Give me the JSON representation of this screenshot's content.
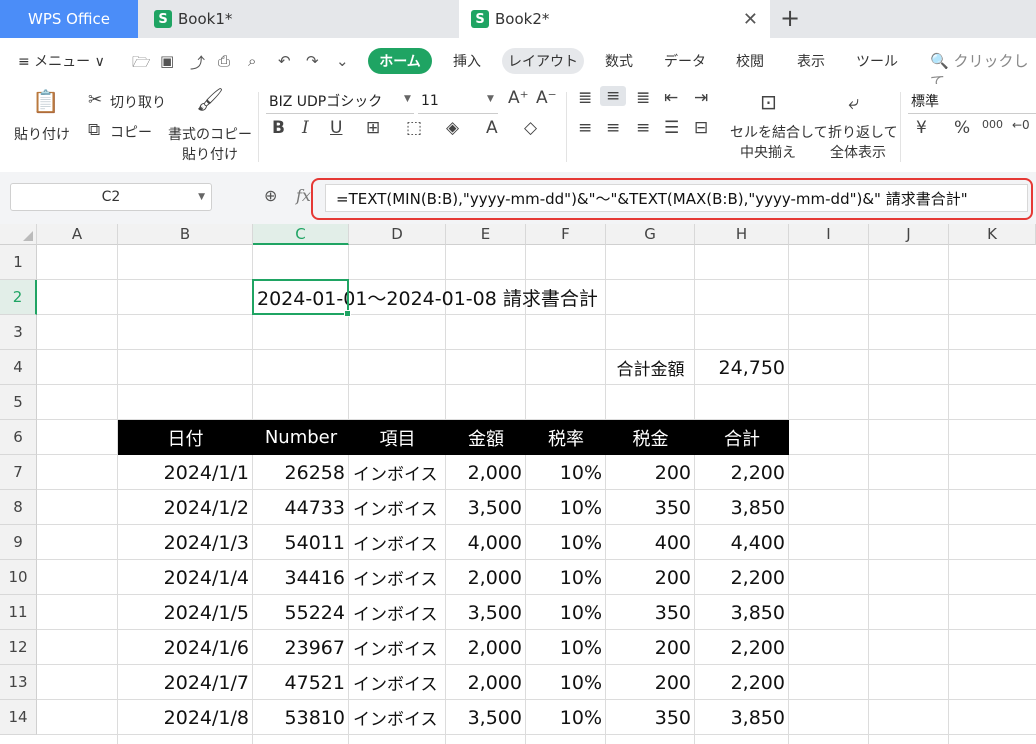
{
  "tabs": {
    "app": "WPS Office",
    "doc1": "Book1*",
    "doc2": "Book2*",
    "doc_icon": "S"
  },
  "menu": {
    "menu_label": "≡ メニュー ∨",
    "tabs": [
      "ホーム",
      "挿入",
      "レイアウト",
      "数式",
      "データ",
      "校閲",
      "表示",
      "ツール"
    ],
    "search": "🔍 クリックして"
  },
  "ribbon": {
    "paste": "貼り付け",
    "cut": "切り取り",
    "copy": "コピー",
    "format_copy_1": "書式のコピー",
    "format_copy_2": "貼り付け",
    "font_name": "BIZ UDPゴシック",
    "font_size": "11",
    "merge_1": "セルを結合して",
    "merge_2": "中央揃え",
    "wrap_1": "折り返して",
    "wrap_2": "全体表示",
    "number_format": "標準",
    "yen": "¥",
    "percent": "%",
    "comma": "000"
  },
  "formula_bar": {
    "name_box": "C2",
    "fx": "fx",
    "formula": "=TEXT(MIN(B:B),\"yyyy-mm-dd\")&\"～\"&TEXT(MAX(B:B),\"yyyy-mm-dd\")&\"  請求書合計\""
  },
  "columns": [
    "A",
    "B",
    "C",
    "D",
    "E",
    "F",
    "G",
    "H",
    "I",
    "J",
    "K"
  ],
  "rows": [
    "1",
    "2",
    "3",
    "4",
    "5",
    "6",
    "7",
    "8",
    "9",
    "10",
    "11",
    "12",
    "13",
    "14"
  ],
  "sheet": {
    "c2_text": "2024-01-01～2024-01-08  請求書合計",
    "g4_label": "合計金額",
    "h4_value": "24,750",
    "table_headers": [
      "日付",
      "Number",
      "項目",
      "金額",
      "税率",
      "税金",
      "合計"
    ],
    "table_rows": [
      [
        "2024/1/1",
        "26258",
        "インボイス",
        "2,000",
        "10%",
        "200",
        "2,200"
      ],
      [
        "2024/1/2",
        "44733",
        "インボイス",
        "3,500",
        "10%",
        "350",
        "3,850"
      ],
      [
        "2024/1/3",
        "54011",
        "インボイス",
        "4,000",
        "10%",
        "400",
        "4,400"
      ],
      [
        "2024/1/4",
        "34416",
        "インボイス",
        "2,000",
        "10%",
        "200",
        "2,200"
      ],
      [
        "2024/1/5",
        "55224",
        "インボイス",
        "3,500",
        "10%",
        "350",
        "3,850"
      ],
      [
        "2024/1/6",
        "23967",
        "インボイス",
        "2,000",
        "10%",
        "200",
        "2,200"
      ],
      [
        "2024/1/7",
        "47521",
        "インボイス",
        "2,000",
        "10%",
        "200",
        "2,200"
      ],
      [
        "2024/1/8",
        "53810",
        "インボイス",
        "3,500",
        "10%",
        "350",
        "3,850"
      ]
    ]
  },
  "colors": {
    "accent_green": "#1fa463",
    "wps_blue": "#4b8df8",
    "highlight_red": "#e53935",
    "table_header_bg": "#000000"
  }
}
